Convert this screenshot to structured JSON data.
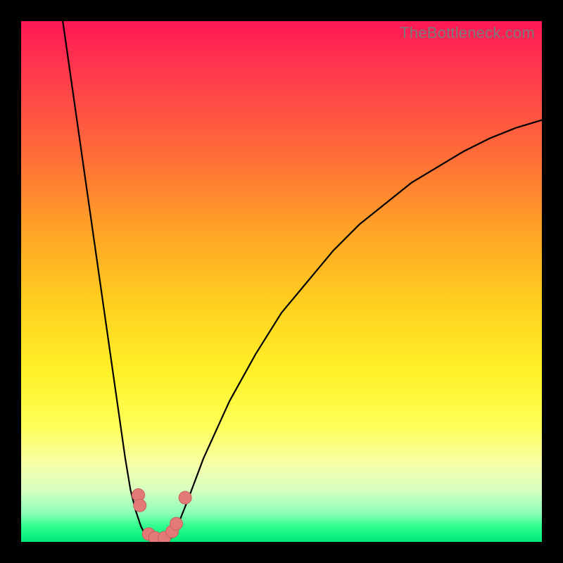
{
  "watermark": "TheBottleneck.com",
  "colors": {
    "background": "#000000",
    "curve_stroke": "#000000",
    "marker_fill": "#e47a78",
    "marker_stroke": "#c95f5d",
    "gradient_top": "#ff1855",
    "gradient_bottom": "#00e87a"
  },
  "chart_data": {
    "type": "line",
    "title": "",
    "xlabel": "",
    "ylabel": "",
    "xlim": [
      0,
      100
    ],
    "ylim": [
      0,
      100
    ],
    "series": [
      {
        "name": "left-branch",
        "x": [
          8,
          10,
          12,
          14,
          16,
          18,
          20,
          21,
          22,
          23,
          24,
          25
        ],
        "y": [
          100,
          86,
          72,
          58,
          44,
          30,
          16,
          10,
          6,
          3,
          1,
          0
        ]
      },
      {
        "name": "right-branch",
        "x": [
          28,
          29,
          30,
          32,
          35,
          40,
          45,
          50,
          55,
          60,
          65,
          70,
          75,
          80,
          85,
          90,
          95,
          100
        ],
        "y": [
          0,
          1,
          3,
          8,
          16,
          27,
          36,
          44,
          50,
          56,
          61,
          65,
          69,
          72,
          75,
          77.5,
          79.5,
          81
        ]
      }
    ],
    "markers": [
      {
        "x": 22.5,
        "y": 9
      },
      {
        "x": 22.8,
        "y": 7
      },
      {
        "x": 24.5,
        "y": 1.5
      },
      {
        "x": 25.7,
        "y": 0.8
      },
      {
        "x": 27.5,
        "y": 0.8
      },
      {
        "x": 29.0,
        "y": 2.0
      },
      {
        "x": 29.8,
        "y": 3.5
      },
      {
        "x": 31.5,
        "y": 8.5
      }
    ]
  }
}
